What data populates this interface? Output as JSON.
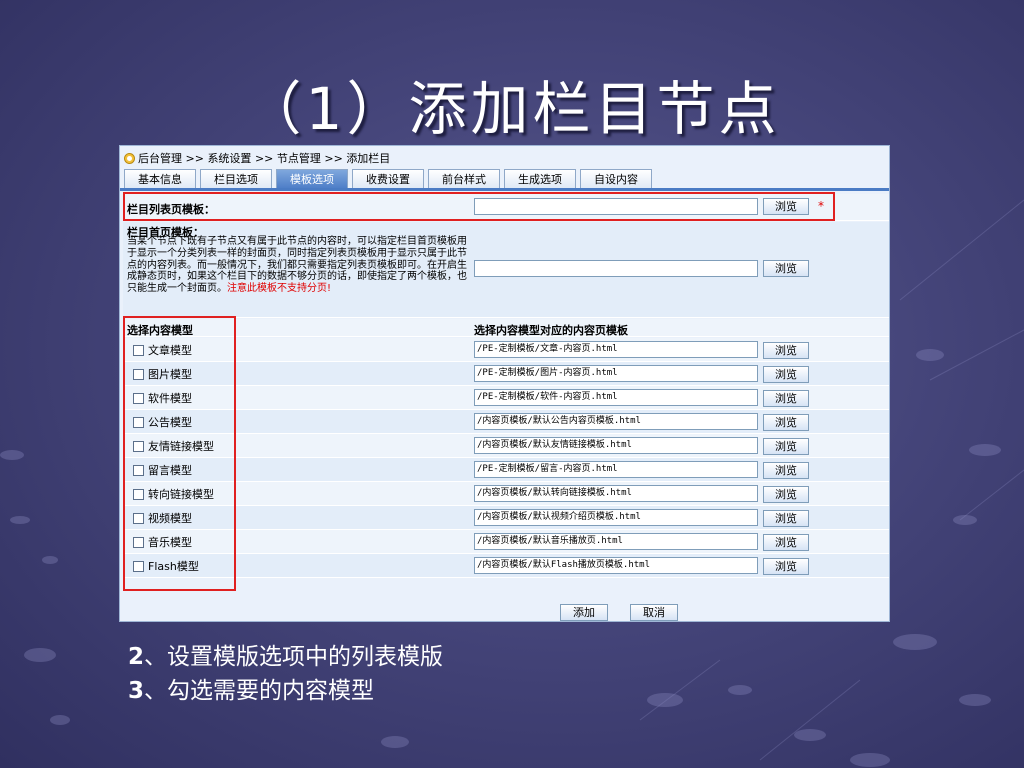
{
  "slide": {
    "title": "（1）添加栏目节点",
    "bullets": [
      {
        "num": "2",
        "text": "、设置模版选项中的列表模版"
      },
      {
        "num": "3",
        "text": "、勾选需要的内容模型"
      }
    ]
  },
  "breadcrumb": {
    "items": [
      "后台管理",
      "系统设置",
      "节点管理",
      "添加栏目"
    ],
    "separator": ">>"
  },
  "tabs": [
    "基本信息",
    "栏目选项",
    "模板选项",
    "收费设置",
    "前台样式",
    "生成选项",
    "自设内容"
  ],
  "active_tab": "模板选项",
  "list_template": {
    "label": "栏目列表页模板：",
    "value": "",
    "browse": "浏览",
    "required": "*"
  },
  "home_template": {
    "label": "栏目首页模板：",
    "desc": "当某个节点下既有子节点又有属于此节点的内容时，可以指定栏目首页模板用于显示一个分类列表一样的封面页，同时指定列表页模板用于显示只属于此节点的内容列表。而一般情况下，我们都只需要指定列表页模板即可。在开启生成静态页时，如果这个栏目下的数据不够分页的话，即使指定了两个模板，也只能生成一个封面页。",
    "warning": "注意此模板不支持分页!",
    "value": "",
    "browse": "浏览"
  },
  "content_models": {
    "header_left": "选择内容模型",
    "header_right": "选择内容模型对应的内容页模板",
    "browse": "浏览",
    "items": [
      {
        "name": "文章模型",
        "template": "/PE-定制模板/文章-内容页.html"
      },
      {
        "name": "图片模型",
        "template": "/PE-定制模板/图片-内容页.html"
      },
      {
        "name": "软件模型",
        "template": "/PE-定制模板/软件-内容页.html"
      },
      {
        "name": "公告模型",
        "template": "/内容页模板/默认公告内容页模板.html"
      },
      {
        "name": "友情链接模型",
        "template": "/内容页模板/默认友情链接模板.html"
      },
      {
        "name": "留言模型",
        "template": "/PE-定制模板/留言-内容页.html"
      },
      {
        "name": "转向链接模型",
        "template": "/内容页模板/默认转向链接模板.html"
      },
      {
        "name": "视频模型",
        "template": "/内容页模板/默认视频介绍页模板.html"
      },
      {
        "name": "音乐模型",
        "template": "/内容页模板/默认音乐播放页.html"
      },
      {
        "name": "Flash模型",
        "template": "/内容页模板/默认Flash播放页模板.html"
      }
    ]
  },
  "footer": {
    "add": "添加",
    "cancel": "取消"
  },
  "colors": {
    "accent": "#4a7bc4",
    "highlight_box": "#e02020",
    "warning": "#e00000"
  }
}
